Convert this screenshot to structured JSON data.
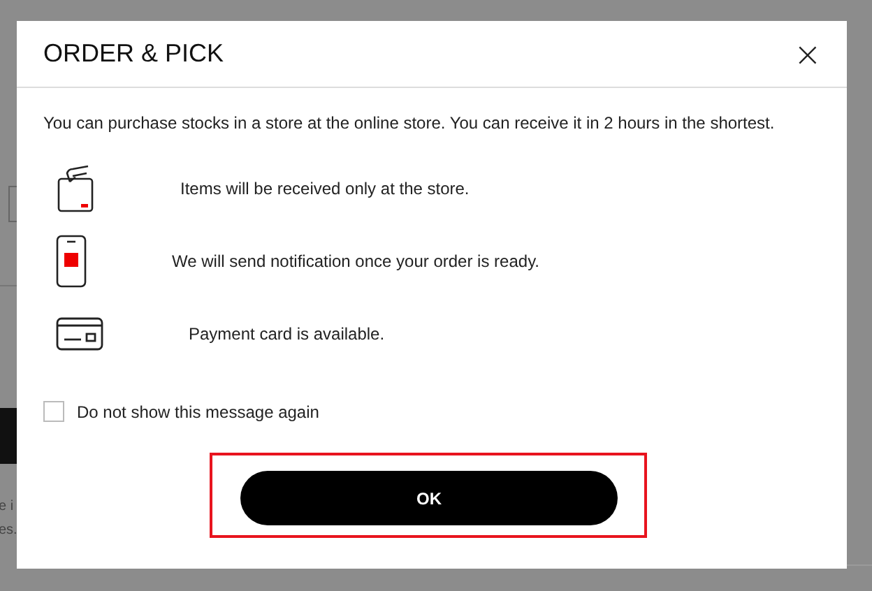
{
  "background_page": {
    "fragments": [
      "e i",
      "es."
    ]
  },
  "dialog": {
    "title": "ORDER & PICK",
    "close": "×",
    "intro": "You can purchase stocks in a store at the online store. You can receive it in 2 hours in the shortest.",
    "features": [
      {
        "kind": "store",
        "text": "Items will be received only at the store."
      },
      {
        "kind": "phone",
        "text": "We will send notification once your order is ready."
      },
      {
        "kind": "card",
        "text": "Payment card is available."
      }
    ],
    "checkbox": {
      "label": "Do not show this message again",
      "checked": false
    },
    "ok_button": {
      "label": "OK",
      "highlighted": true
    }
  }
}
